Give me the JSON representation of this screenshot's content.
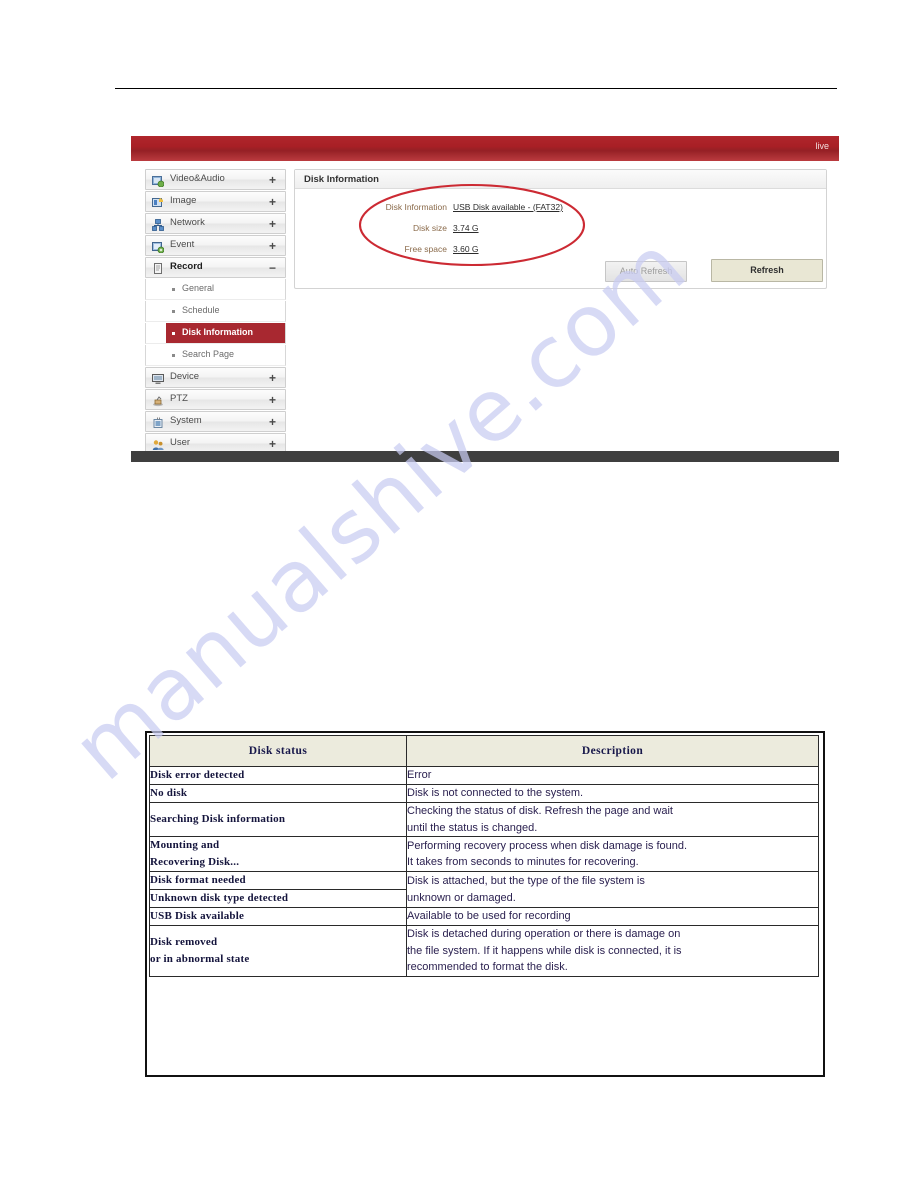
{
  "device_ui": {
    "header": {
      "live_label": "live"
    },
    "sidebar": {
      "top_items": [
        {
          "label": "Video&Audio",
          "sign": "+",
          "icon": "video-audio-icon"
        },
        {
          "label": "Image",
          "sign": "+",
          "icon": "image-icon"
        },
        {
          "label": "Network",
          "sign": "+",
          "icon": "network-icon"
        },
        {
          "label": "Event",
          "sign": "+",
          "icon": "event-icon"
        },
        {
          "label": "Record",
          "sign": "−",
          "icon": "record-icon"
        }
      ],
      "sub_items": [
        {
          "label": "General"
        },
        {
          "label": "Schedule"
        },
        {
          "label": "Disk Information"
        },
        {
          "label": "Search Page"
        }
      ],
      "bottom_items": [
        {
          "label": "Device",
          "sign": "+",
          "icon": "device-icon"
        },
        {
          "label": "PTZ",
          "sign": "+",
          "icon": "ptz-icon"
        },
        {
          "label": "System",
          "sign": "+",
          "icon": "system-icon"
        },
        {
          "label": "User",
          "sign": "+",
          "icon": "user-icon"
        }
      ],
      "selected_sub": "Disk Information",
      "expanded_top": "Record"
    },
    "panel": {
      "title": "Disk Information",
      "fields": [
        {
          "label": "Disk Information",
          "value": "USB Disk available - (FAT32)"
        },
        {
          "label": "Disk size",
          "value": "3.74 G"
        },
        {
          "label": "Free space",
          "value": "3.60 G"
        }
      ],
      "buttons": {
        "auto_refresh": "Auto Refresh",
        "refresh": "Refresh"
      }
    },
    "annotation": {
      "shape": "ellipse",
      "color": "#cc2a33"
    }
  },
  "status_table": {
    "headers": [
      "Disk status",
      "Description"
    ],
    "rows": [
      {
        "status": [
          "Disk error detected"
        ],
        "desc": [
          "Error"
        ]
      },
      {
        "status": [
          "No disk"
        ],
        "desc": [
          "Disk is not connected to the system."
        ]
      },
      {
        "status": [
          "Searching Disk information"
        ],
        "desc": [
          "Checking the status of disk. Refresh the page and wait",
          "until the status is changed."
        ]
      },
      {
        "status": [
          "Mounting and",
          "Recovering Disk..."
        ],
        "desc": [
          "Performing recovery process when disk damage is found.",
          "It takes from seconds to minutes for recovering."
        ]
      },
      {
        "status_split": [
          "Disk format needed",
          "Unknown disk type detected"
        ],
        "desc": [
          "Disk is attached, but the type of the file system is",
          "unknown or damaged."
        ]
      },
      {
        "status": [
          "USB Disk available"
        ],
        "desc": [
          "Available to be used for recording"
        ]
      },
      {
        "status": [
          "Disk removed",
          "or in abnormal state"
        ],
        "desc": [
          "Disk is detached during operation or there is damage on",
          "the file system. If it happens while disk is connected, it is",
          "recommended to format the disk."
        ]
      }
    ]
  },
  "watermark": {
    "text": "manualshive.com"
  },
  "colors": {
    "brand_red": "#a82830",
    "header_red": "#a81f25",
    "annotation_red": "#cc2a33",
    "table_header_bg": "#ecebdd",
    "refresh_btn_bg": "#e9e7d4",
    "footer_gray": "#3f3f3f",
    "watermark": "#c9ccf2"
  }
}
